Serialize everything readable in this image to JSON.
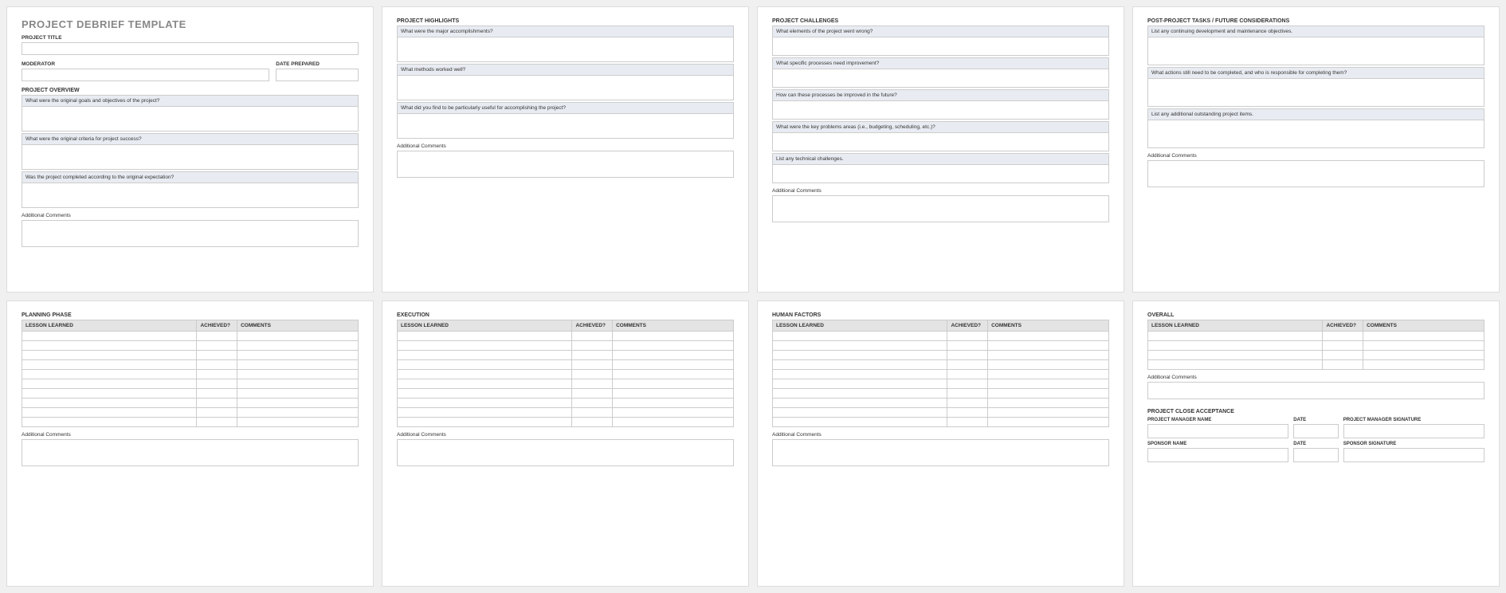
{
  "doc_title": "PROJECT DEBRIEF TEMPLATE",
  "p1": {
    "project_title_label": "PROJECT TITLE",
    "moderator_label": "MODERATOR",
    "date_prepared_label": "DATE PREPARED",
    "overview_heading": "PROJECT OVERVIEW",
    "q1": "What were the original goals and objectives of the project?",
    "q2": "What were the original criteria for project success?",
    "q3": "Was the project completed according to the original expectation?",
    "additional": "Additional Comments"
  },
  "p2": {
    "heading": "PROJECT HIGHLIGHTS",
    "q1": "What were the major accomplishments?",
    "q2": "What methods worked well?",
    "q3": "What did you find to be particularly useful for accomplishing the project?",
    "additional": "Additional Comments"
  },
  "p3": {
    "heading": "PROJECT CHALLENGES",
    "q1": "What elements of the project went wrong?",
    "q2": "What specific processes need improvement?",
    "q3": "How can these processes be improved in the future?",
    "q4": "What were the key problems areas (i.e., budgeting, scheduling, etc.)?",
    "q5": "List any technical challenges.",
    "additional": "Additional Comments"
  },
  "p4": {
    "heading": "POST-PROJECT TASKS / FUTURE CONSIDERATIONS",
    "q1": "List any continuing development and maintenance objectives.",
    "q2": "What actions still need to be completed, and who is responsible for completing them?",
    "q3": "List any additional outstanding project items.",
    "additional": "Additional Comments"
  },
  "lessons_cols": {
    "c1": "LESSON LEARNED",
    "c2": "ACHIEVED?",
    "c3": "COMMENTS"
  },
  "p5": {
    "heading": "PLANNING PHASE",
    "additional": "Additional Comments"
  },
  "p6": {
    "heading": "EXECUTION",
    "additional": "Additional Comments"
  },
  "p7": {
    "heading": "HUMAN FACTORS",
    "additional": "Additional Comments"
  },
  "p8": {
    "overall_heading": "OVERALL",
    "additional": "Additional Comments",
    "close_heading": "PROJECT CLOSE ACCEPTANCE",
    "pm_name": "PROJECT MANAGER NAME",
    "date": "DATE",
    "pm_sig": "PROJECT MANAGER SIGNATURE",
    "sponsor_name": "SPONSOR NAME",
    "sponsor_sig": "SPONSOR SIGNATURE"
  }
}
